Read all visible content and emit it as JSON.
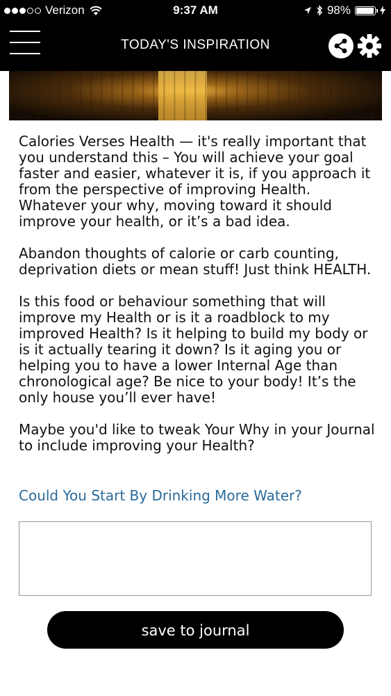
{
  "status_bar": {
    "carrier": "Verizon",
    "time": "9:37 AM",
    "battery_percent": "98%",
    "battery_level": 0.98,
    "signal_bars_filled": 3,
    "signal_bars_total": 5
  },
  "nav": {
    "title": "TODAY'S INSPIRATION",
    "menu_icon": "hamburger-icon",
    "share_icon": "share-icon",
    "settings_icon": "gear-icon"
  },
  "content": {
    "paragraphs": [
      "Calories Verses Health — it's really important that you understand this – You will achieve your goal faster and easier, whatever it is, if you approach it from the perspective of improving Health. Whatever your why, moving toward it should improve your health, or it’s a bad idea.",
      "Abandon thoughts of calorie or carb counting, deprivation diets or mean stuff!  Just think HEALTH.",
      "Is this food or behaviour something that will improve my Health or is it a roadblock to my improved Health?  Is it helping to build my body or is it actually tearing it down?  Is it aging you or helping you to have a lower Internal Age than chronological age?  Be nice to your body!  It’s the only house you’ll ever have!",
      "Maybe you'd like to tweak Your Why in your Journal to include improving your Health?"
    ],
    "question_link": "Could You Start By Drinking More Water?"
  },
  "journal": {
    "value": "",
    "save_label": "save to journal"
  },
  "colors": {
    "link": "#2a6a9a",
    "nav_background": "#000000"
  }
}
